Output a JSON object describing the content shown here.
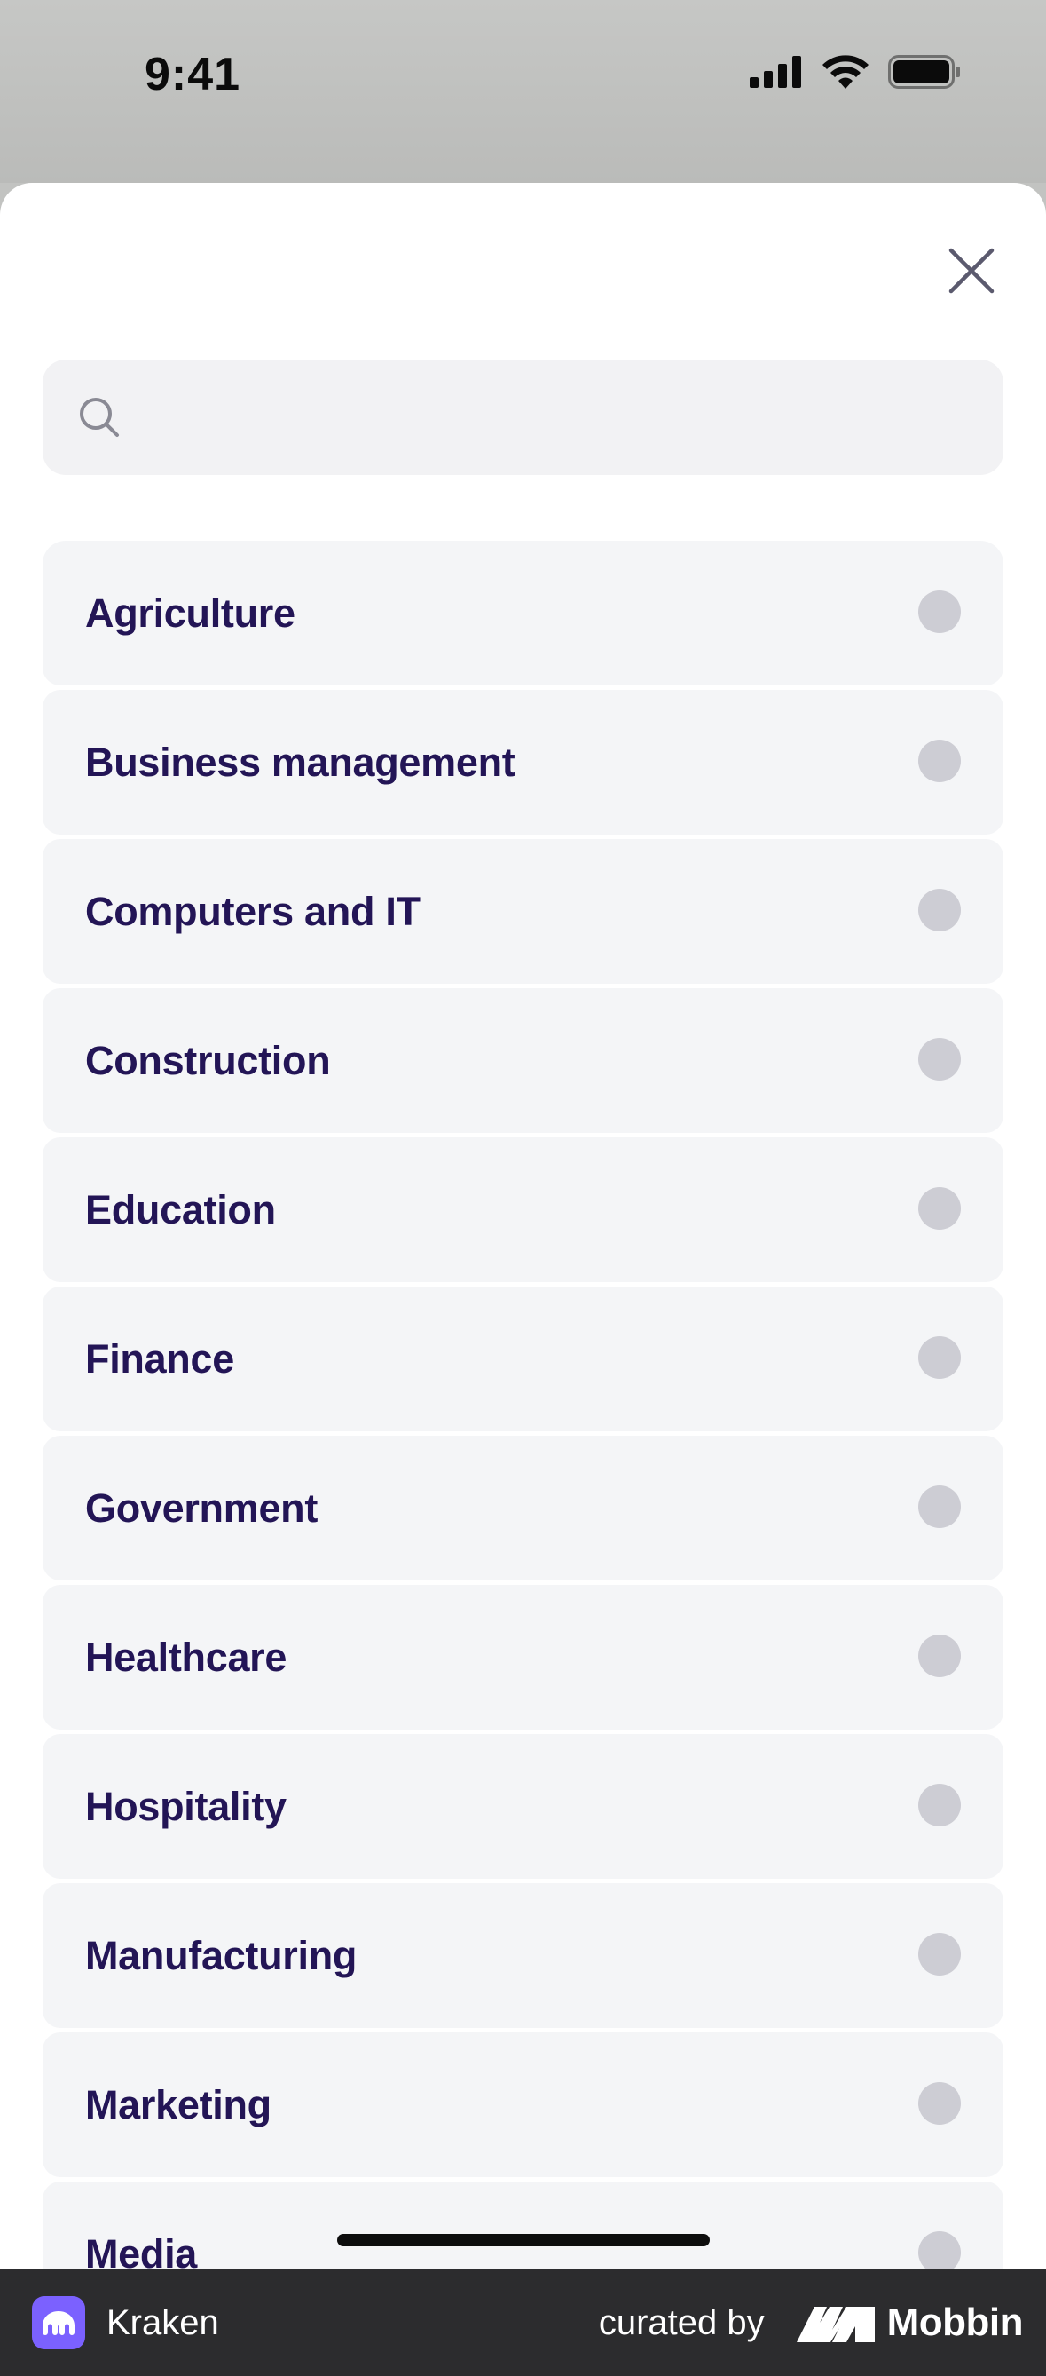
{
  "status_bar": {
    "time": "9:41",
    "icons": [
      "signal-icon",
      "wifi-icon",
      "battery-icon"
    ]
  },
  "sheet": {
    "close_icon": "close-icon",
    "search": {
      "icon": "search-icon",
      "placeholder": "",
      "value": ""
    },
    "options": [
      {
        "label": "Agriculture",
        "selected": false
      },
      {
        "label": "Business management",
        "selected": false
      },
      {
        "label": "Computers and IT",
        "selected": false
      },
      {
        "label": "Construction",
        "selected": false
      },
      {
        "label": "Education",
        "selected": false
      },
      {
        "label": "Finance",
        "selected": false
      },
      {
        "label": "Government",
        "selected": false
      },
      {
        "label": "Healthcare",
        "selected": false
      },
      {
        "label": "Hospitality",
        "selected": false
      },
      {
        "label": "Manufacturing",
        "selected": false
      },
      {
        "label": "Marketing",
        "selected": false
      },
      {
        "label": "Media",
        "selected": false
      }
    ]
  },
  "footer": {
    "app_name": "Kraken",
    "curated_by": "curated by",
    "brand": "Mobbin"
  },
  "colors": {
    "label_text": "#231556",
    "row_bg": "#f4f5f7",
    "radio": "#cdcdd4",
    "kraken_purple": "#7b61ff",
    "footer_bg": "#2c2c2e"
  }
}
